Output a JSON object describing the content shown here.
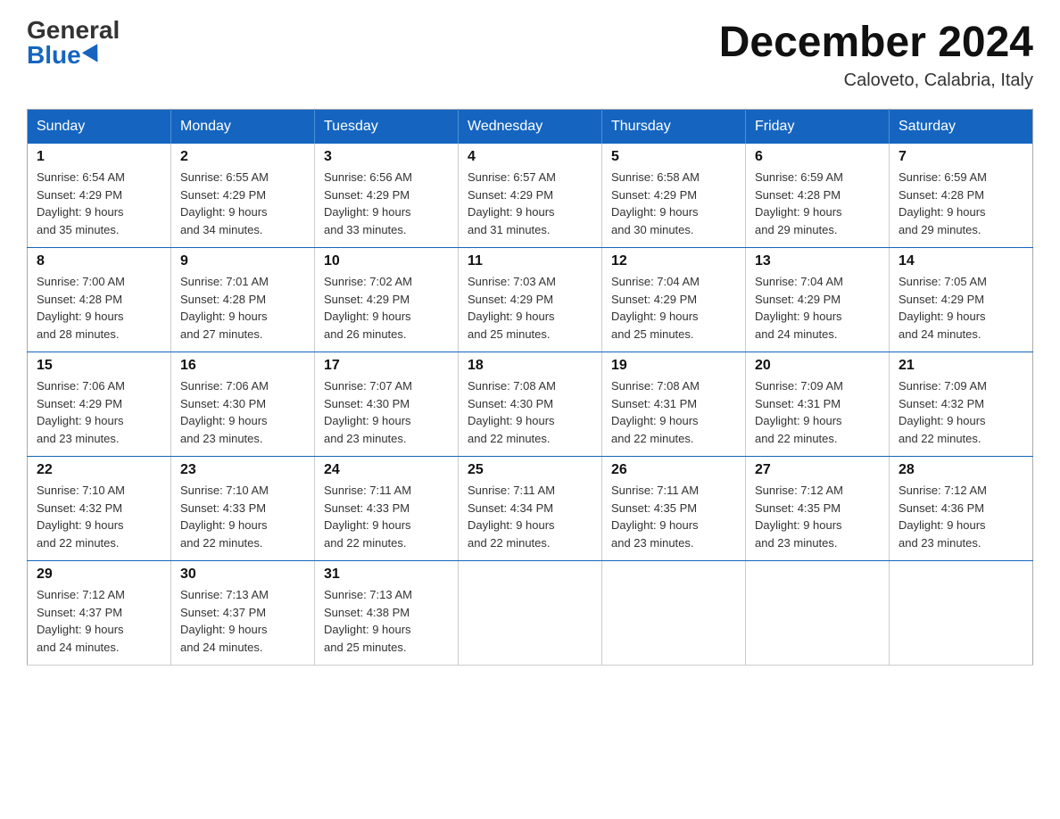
{
  "logo": {
    "general": "General",
    "blue": "Blue"
  },
  "title": "December 2024",
  "location": "Caloveto, Calabria, Italy",
  "days_of_week": [
    "Sunday",
    "Monday",
    "Tuesday",
    "Wednesday",
    "Thursday",
    "Friday",
    "Saturday"
  ],
  "weeks": [
    [
      {
        "day": "1",
        "sunrise": "6:54 AM",
        "sunset": "4:29 PM",
        "daylight": "9 hours and 35 minutes."
      },
      {
        "day": "2",
        "sunrise": "6:55 AM",
        "sunset": "4:29 PM",
        "daylight": "9 hours and 34 minutes."
      },
      {
        "day": "3",
        "sunrise": "6:56 AM",
        "sunset": "4:29 PM",
        "daylight": "9 hours and 33 minutes."
      },
      {
        "day": "4",
        "sunrise": "6:57 AM",
        "sunset": "4:29 PM",
        "daylight": "9 hours and 31 minutes."
      },
      {
        "day": "5",
        "sunrise": "6:58 AM",
        "sunset": "4:29 PM",
        "daylight": "9 hours and 30 minutes."
      },
      {
        "day": "6",
        "sunrise": "6:59 AM",
        "sunset": "4:28 PM",
        "daylight": "9 hours and 29 minutes."
      },
      {
        "day": "7",
        "sunrise": "6:59 AM",
        "sunset": "4:28 PM",
        "daylight": "9 hours and 29 minutes."
      }
    ],
    [
      {
        "day": "8",
        "sunrise": "7:00 AM",
        "sunset": "4:28 PM",
        "daylight": "9 hours and 28 minutes."
      },
      {
        "day": "9",
        "sunrise": "7:01 AM",
        "sunset": "4:28 PM",
        "daylight": "9 hours and 27 minutes."
      },
      {
        "day": "10",
        "sunrise": "7:02 AM",
        "sunset": "4:29 PM",
        "daylight": "9 hours and 26 minutes."
      },
      {
        "day": "11",
        "sunrise": "7:03 AM",
        "sunset": "4:29 PM",
        "daylight": "9 hours and 25 minutes."
      },
      {
        "day": "12",
        "sunrise": "7:04 AM",
        "sunset": "4:29 PM",
        "daylight": "9 hours and 25 minutes."
      },
      {
        "day": "13",
        "sunrise": "7:04 AM",
        "sunset": "4:29 PM",
        "daylight": "9 hours and 24 minutes."
      },
      {
        "day": "14",
        "sunrise": "7:05 AM",
        "sunset": "4:29 PM",
        "daylight": "9 hours and 24 minutes."
      }
    ],
    [
      {
        "day": "15",
        "sunrise": "7:06 AM",
        "sunset": "4:29 PM",
        "daylight": "9 hours and 23 minutes."
      },
      {
        "day": "16",
        "sunrise": "7:06 AM",
        "sunset": "4:30 PM",
        "daylight": "9 hours and 23 minutes."
      },
      {
        "day": "17",
        "sunrise": "7:07 AM",
        "sunset": "4:30 PM",
        "daylight": "9 hours and 23 minutes."
      },
      {
        "day": "18",
        "sunrise": "7:08 AM",
        "sunset": "4:30 PM",
        "daylight": "9 hours and 22 minutes."
      },
      {
        "day": "19",
        "sunrise": "7:08 AM",
        "sunset": "4:31 PM",
        "daylight": "9 hours and 22 minutes."
      },
      {
        "day": "20",
        "sunrise": "7:09 AM",
        "sunset": "4:31 PM",
        "daylight": "9 hours and 22 minutes."
      },
      {
        "day": "21",
        "sunrise": "7:09 AM",
        "sunset": "4:32 PM",
        "daylight": "9 hours and 22 minutes."
      }
    ],
    [
      {
        "day": "22",
        "sunrise": "7:10 AM",
        "sunset": "4:32 PM",
        "daylight": "9 hours and 22 minutes."
      },
      {
        "day": "23",
        "sunrise": "7:10 AM",
        "sunset": "4:33 PM",
        "daylight": "9 hours and 22 minutes."
      },
      {
        "day": "24",
        "sunrise": "7:11 AM",
        "sunset": "4:33 PM",
        "daylight": "9 hours and 22 minutes."
      },
      {
        "day": "25",
        "sunrise": "7:11 AM",
        "sunset": "4:34 PM",
        "daylight": "9 hours and 22 minutes."
      },
      {
        "day": "26",
        "sunrise": "7:11 AM",
        "sunset": "4:35 PM",
        "daylight": "9 hours and 23 minutes."
      },
      {
        "day": "27",
        "sunrise": "7:12 AM",
        "sunset": "4:35 PM",
        "daylight": "9 hours and 23 minutes."
      },
      {
        "day": "28",
        "sunrise": "7:12 AM",
        "sunset": "4:36 PM",
        "daylight": "9 hours and 23 minutes."
      }
    ],
    [
      {
        "day": "29",
        "sunrise": "7:12 AM",
        "sunset": "4:37 PM",
        "daylight": "9 hours and 24 minutes."
      },
      {
        "day": "30",
        "sunrise": "7:13 AM",
        "sunset": "4:37 PM",
        "daylight": "9 hours and 24 minutes."
      },
      {
        "day": "31",
        "sunrise": "7:13 AM",
        "sunset": "4:38 PM",
        "daylight": "9 hours and 25 minutes."
      },
      null,
      null,
      null,
      null
    ]
  ],
  "labels": {
    "sunrise": "Sunrise:",
    "sunset": "Sunset:",
    "daylight": "Daylight:"
  }
}
